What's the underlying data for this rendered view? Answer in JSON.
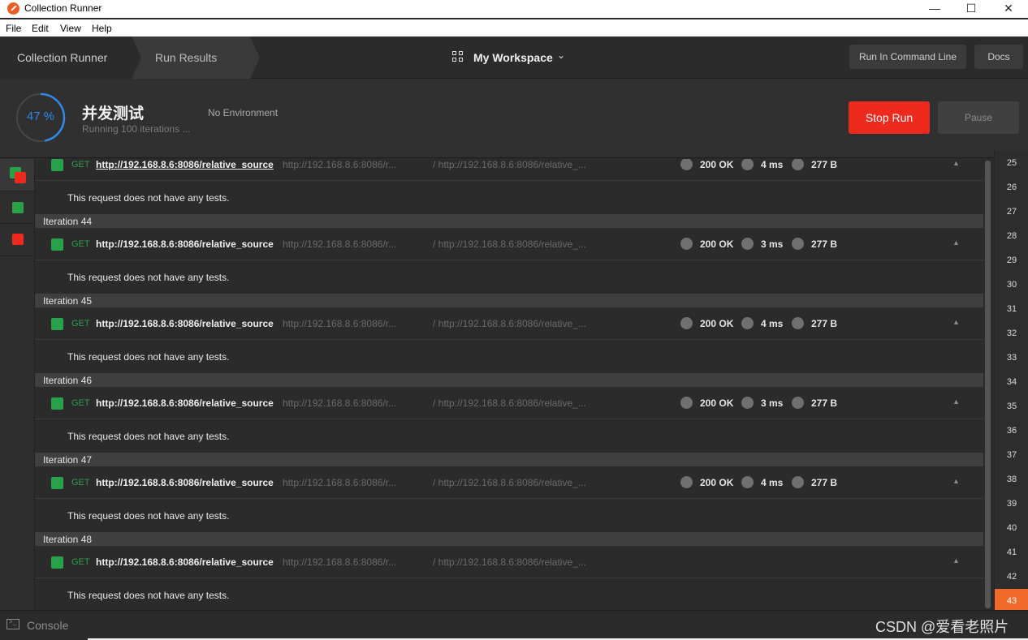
{
  "window": {
    "title": "Collection Runner",
    "min_glyph": "—",
    "max_glyph": "☐",
    "close_glyph": "✕"
  },
  "menu": [
    "File",
    "Edit",
    "View",
    "Help"
  ],
  "header": {
    "crumb_runner": "Collection Runner",
    "crumb_results": "Run Results",
    "workspace": "My Workspace",
    "chevron": "⌄",
    "run_cmdline": "Run In Command Line",
    "docs": "Docs"
  },
  "run": {
    "progress_label": "47 %",
    "progress_value": 0.47,
    "name": "并发测试",
    "subtitle": "Running 100 iterations ...",
    "environment": "No Environment",
    "stop": "Stop Run",
    "pause": "Pause"
  },
  "colors": {
    "accent_blue": "#2d8ae8",
    "stop_red": "#ed2a1c",
    "pass_green": "#27a24b",
    "active_iteration": "#f2692c"
  },
  "request": {
    "method": "GET",
    "url": "http://192.168.8.6:8086/relative_source",
    "url_short": "http://192.168.8.6:8086/r...",
    "url_path": "/ http://192.168.8.6:8086/relative_..."
  },
  "no_tests": "This request does not have any tests.",
  "first_row": {
    "status": "200 OK",
    "time": "4 ms",
    "size": "277 B"
  },
  "iterations": [
    {
      "label": "Iteration 44",
      "status": "200 OK",
      "time": "3 ms",
      "size": "277 B"
    },
    {
      "label": "Iteration 45",
      "status": "200 OK",
      "time": "4 ms",
      "size": "277 B"
    },
    {
      "label": "Iteration 46",
      "status": "200 OK",
      "time": "3 ms",
      "size": "277 B"
    },
    {
      "label": "Iteration 47",
      "status": "200 OK",
      "time": "4 ms",
      "size": "277 B"
    },
    {
      "label": "Iteration 48",
      "status": "",
      "time": "",
      "size": ""
    }
  ],
  "iteration_numbers": [
    "25",
    "26",
    "27",
    "28",
    "29",
    "30",
    "31",
    "32",
    "33",
    "34",
    "35",
    "36",
    "37",
    "38",
    "39",
    "40",
    "41",
    "42",
    "43"
  ],
  "active_iteration": "43",
  "footer": {
    "console": "Console",
    "watermark": "CSDN @爱看老照片"
  }
}
